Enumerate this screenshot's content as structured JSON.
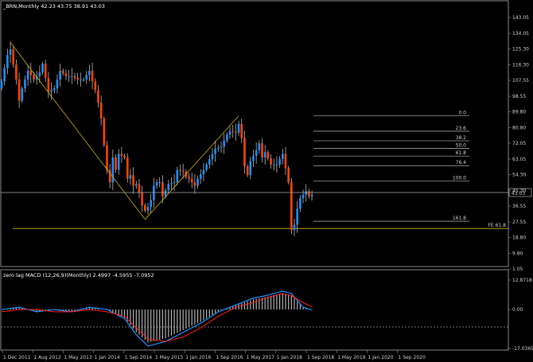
{
  "main_panel": {
    "header": "_BRN,Monthly  42.23 43.75 38.91 43.03",
    "price_ticks": [
      "143.05",
      "134.05",
      "125.30",
      "116.30",
      "107.55",
      "98.55",
      "89.80",
      "80.80",
      "72.05",
      "63.05",
      "54.30",
      "45.30",
      "36.55",
      "27.55",
      "18.80",
      "9.80",
      "1.05"
    ],
    "current_price": "43.03",
    "fib_levels": [
      {
        "label": "0.0",
        "value": 87.5
      },
      {
        "label": "23.6",
        "value": 78.8
      },
      {
        "label": "38.2",
        "value": 73.4
      },
      {
        "label": "50.0",
        "value": 69.1
      },
      {
        "label": "61.8",
        "value": 64.8
      },
      {
        "label": "76.4",
        "value": 59.4
      },
      {
        "label": "100.0",
        "value": 50.7
      },
      {
        "label": "161.8",
        "value": 28.0
      }
    ],
    "fe_label": "FE 61.8",
    "fe_value": 23.9
  },
  "macd_panel": {
    "header": "zero lag MACD (12,26,9)(Monthly) 2.4997 -4.5955 -7.0952",
    "ticks": [
      "12.8718",
      "0.00",
      "-17.0365"
    ]
  },
  "x_axis": [
    "1 Dec 2011",
    "1 Aug 2012",
    "1 May 2013",
    "1 Jan 2014",
    "1 Sep 2014",
    "1 May 2015",
    "1 Jan 2016",
    "1 Sep 2016",
    "1 May 2017",
    "1 Jan 2018",
    "1 Sep 2018",
    "1 May 2019",
    "1 Jan 2020",
    "1 Sep 2020"
  ],
  "colors": {
    "bull": "#1e90ff",
    "bear": "#ff4500",
    "trend": "#c8b400",
    "fe": "#d4c000",
    "grid": "#8a8a8a",
    "macd_line": "#1e90ff",
    "signal_line": "#ff2020",
    "hist": "#b4b4b4"
  },
  "chart_data": [
    {
      "type": "candlestick",
      "title": "_BRN,Monthly",
      "ylim": [
        1.05,
        143.05
      ],
      "close_points": [
        [
          "2011-12",
          107
        ],
        [
          "2012-02",
          122
        ],
        [
          "2012-03",
          125
        ],
        [
          "2012-05",
          108
        ],
        [
          "2012-06",
          96
        ],
        [
          "2012-07",
          103
        ],
        [
          "2012-09",
          113
        ],
        [
          "2012-11",
          108
        ],
        [
          "2013-01",
          112
        ],
        [
          "2013-02",
          117
        ],
        [
          "2013-04",
          101
        ],
        [
          "2013-06",
          103
        ],
        [
          "2013-08",
          113
        ],
        [
          "2013-10",
          110
        ],
        [
          "2013-12",
          110
        ],
        [
          "2014-02",
          108
        ],
        [
          "2014-04",
          108
        ],
        [
          "2014-06",
          113
        ],
        [
          "2014-07",
          107
        ],
        [
          "2014-08",
          102
        ],
        [
          "2014-09",
          95
        ],
        [
          "2014-10",
          86
        ],
        [
          "2014-11",
          71
        ],
        [
          "2014-12",
          57
        ],
        [
          "2015-01",
          50
        ],
        [
          "2015-02",
          64
        ],
        [
          "2015-03",
          57
        ],
        [
          "2015-04",
          66
        ],
        [
          "2015-05",
          65
        ],
        [
          "2015-06",
          64
        ],
        [
          "2015-07",
          52
        ],
        [
          "2015-08",
          54
        ],
        [
          "2015-09",
          48
        ],
        [
          "2015-10",
          49
        ],
        [
          "2015-11",
          44
        ],
        [
          "2015-12",
          37
        ],
        [
          "2016-01",
          34
        ],
        [
          "2016-02",
          36
        ],
        [
          "2016-03",
          40
        ],
        [
          "2016-04",
          48
        ],
        [
          "2016-05",
          50
        ],
        [
          "2016-06",
          50
        ],
        [
          "2016-07",
          42
        ],
        [
          "2016-09",
          49
        ],
        [
          "2016-11",
          50
        ],
        [
          "2016-12",
          57
        ],
        [
          "2017-02",
          56
        ],
        [
          "2017-03",
          53
        ],
        [
          "2017-04",
          52
        ],
        [
          "2017-06",
          48
        ],
        [
          "2017-07",
          52
        ],
        [
          "2017-09",
          57
        ],
        [
          "2017-11",
          63
        ],
        [
          "2018-01",
          69
        ],
        [
          "2018-03",
          70
        ],
        [
          "2018-05",
          77
        ],
        [
          "2018-06",
          79
        ],
        [
          "2018-08",
          78
        ],
        [
          "2018-09",
          83
        ],
        [
          "2018-10",
          75
        ],
        [
          "2018-11",
          59
        ],
        [
          "2018-12",
          54
        ],
        [
          "2019-01",
          62
        ],
        [
          "2019-03",
          68
        ],
        [
          "2019-04",
          72
        ],
        [
          "2019-05",
          64
        ],
        [
          "2019-06",
          67
        ],
        [
          "2019-08",
          60
        ],
        [
          "2019-10",
          60
        ],
        [
          "2019-12",
          66
        ],
        [
          "2020-01",
          58
        ],
        [
          "2020-02",
          50
        ],
        [
          "2020-03",
          23
        ],
        [
          "2020-04",
          26
        ],
        [
          "2020-05",
          35
        ],
        [
          "2020-06",
          41
        ],
        [
          "2020-07",
          43
        ],
        [
          "2020-08",
          45
        ],
        [
          "2020-09",
          42
        ],
        [
          "2020-10",
          43
        ]
      ]
    },
    {
      "type": "line",
      "title": "zero lag MACD (12,26,9)(Monthly)",
      "ylim": [
        -17.0365,
        12.8718
      ],
      "series": [
        {
          "name": "",
          "values": [
            [
              0,
              0
            ],
            [
              6,
              1
            ],
            [
              12,
              -1
            ],
            [
              18,
              0
            ],
            [
              24,
              -1
            ],
            [
              30,
              1
            ],
            [
              36,
              0
            ],
            [
              42,
              -4
            ],
            [
              46,
              -11
            ],
            [
              50,
              -16
            ],
            [
              56,
              -14
            ],
            [
              62,
              -10
            ],
            [
              68,
              -6
            ],
            [
              74,
              -1
            ],
            [
              80,
              2
            ],
            [
              86,
              5
            ],
            [
              90,
              6
            ],
            [
              96,
              8
            ],
            [
              99,
              7
            ],
            [
              103,
              1
            ],
            [
              108,
              -1
            ],
            [
              114,
              -1
            ],
            [
              120,
              0
            ],
            [
              124,
              -2
            ],
            [
              127,
              -6
            ],
            [
              130,
              -7
            ],
            [
              134,
              -5
            ],
            [
              138,
              -3
            ]
          ]
        },
        {
          "name": "",
          "values": [
            [
              0,
              -1
            ],
            [
              6,
              0
            ],
            [
              12,
              0
            ],
            [
              18,
              -1
            ],
            [
              24,
              -1
            ],
            [
              30,
              0
            ],
            [
              36,
              -1
            ],
            [
              42,
              -3
            ],
            [
              46,
              -8
            ],
            [
              50,
              -13
            ],
            [
              56,
              -14
            ],
            [
              62,
              -12
            ],
            [
              68,
              -8
            ],
            [
              74,
              -3
            ],
            [
              80,
              1
            ],
            [
              86,
              3
            ],
            [
              90,
              5
            ],
            [
              96,
              7
            ],
            [
              99,
              6
            ],
            [
              103,
              3
            ],
            [
              108,
              0
            ],
            [
              114,
              -1
            ],
            [
              120,
              -1
            ],
            [
              124,
              -1
            ],
            [
              127,
              -3
            ],
            [
              130,
              -5
            ],
            [
              134,
              -5
            ],
            [
              138,
              -4
            ]
          ]
        }
      ]
    }
  ]
}
